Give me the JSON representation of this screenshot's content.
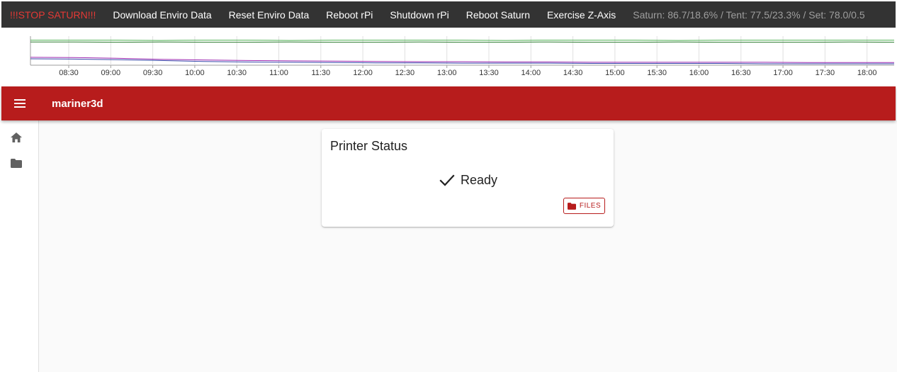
{
  "topbar": {
    "stop_label": "!!!STOP SATURN!!!",
    "actions": [
      "Download Enviro Data",
      "Reset Enviro Data",
      "Reboot rPi",
      "Shutdown rPi",
      "Reboot Saturn",
      "Exercise Z-Axis"
    ],
    "status_text": "Saturn: 86.7/18.6% / Tent: 77.5/23.3% / Set: 78.0/0.5",
    "colors": {
      "background": "#333333",
      "stop": "#e53935",
      "status": "#9e9e9e"
    }
  },
  "chart_data": {
    "type": "line",
    "x_tick_labels": [
      "08:30",
      "09:00",
      "09:30",
      "10:00",
      "10:30",
      "11:00",
      "11:30",
      "12:00",
      "12:30",
      "13:00",
      "13:30",
      "14:00",
      "14:30",
      "15:00",
      "15:30",
      "16:00",
      "16:30",
      "17:00",
      "17:30",
      "18:00"
    ],
    "series": [
      {
        "color": "#4caf50",
        "values": [
          0.86,
          0.86,
          0.86,
          0.85,
          0.86,
          0.86,
          0.85,
          0.86,
          0.86,
          0.86,
          0.86,
          0.85,
          0.86,
          0.86,
          0.86,
          0.85,
          0.86,
          0.86,
          0.86,
          0.86,
          0.86
        ]
      },
      {
        "color": "#2e7d32",
        "values": [
          0.8,
          0.8,
          0.79,
          0.8,
          0.79,
          0.79,
          0.8,
          0.79,
          0.79,
          0.8,
          0.79,
          0.79,
          0.8,
          0.79,
          0.79,
          0.8,
          0.79,
          0.79,
          0.79,
          0.8,
          0.79
        ]
      },
      {
        "color": "#9c27b0",
        "values": [
          0.27,
          0.26,
          0.24,
          0.2,
          0.18,
          0.16,
          0.15,
          0.14,
          0.13,
          0.12,
          0.12,
          0.11,
          0.11,
          0.1,
          0.1,
          0.1,
          0.1,
          0.1,
          0.09,
          0.09,
          0.09
        ]
      },
      {
        "color": "#3949ab",
        "values": [
          0.22,
          0.21,
          0.19,
          0.16,
          0.13,
          0.11,
          0.1,
          0.09,
          0.08,
          0.08,
          0.07,
          0.07,
          0.07,
          0.06,
          0.06,
          0.06,
          0.06,
          0.05,
          0.05,
          0.05,
          0.05
        ]
      }
    ]
  },
  "appbar": {
    "title": "mariner3d",
    "color": "#b71c1c",
    "menu_icon": "menu-icon"
  },
  "sidebar": {
    "items": [
      {
        "icon": "home-icon"
      },
      {
        "icon": "folder-icon"
      }
    ]
  },
  "card": {
    "title": "Printer Status",
    "state_icon": "check-icon",
    "state_label": "Ready",
    "files_button_label": "FILES",
    "files_button_icon": "folder-icon"
  }
}
